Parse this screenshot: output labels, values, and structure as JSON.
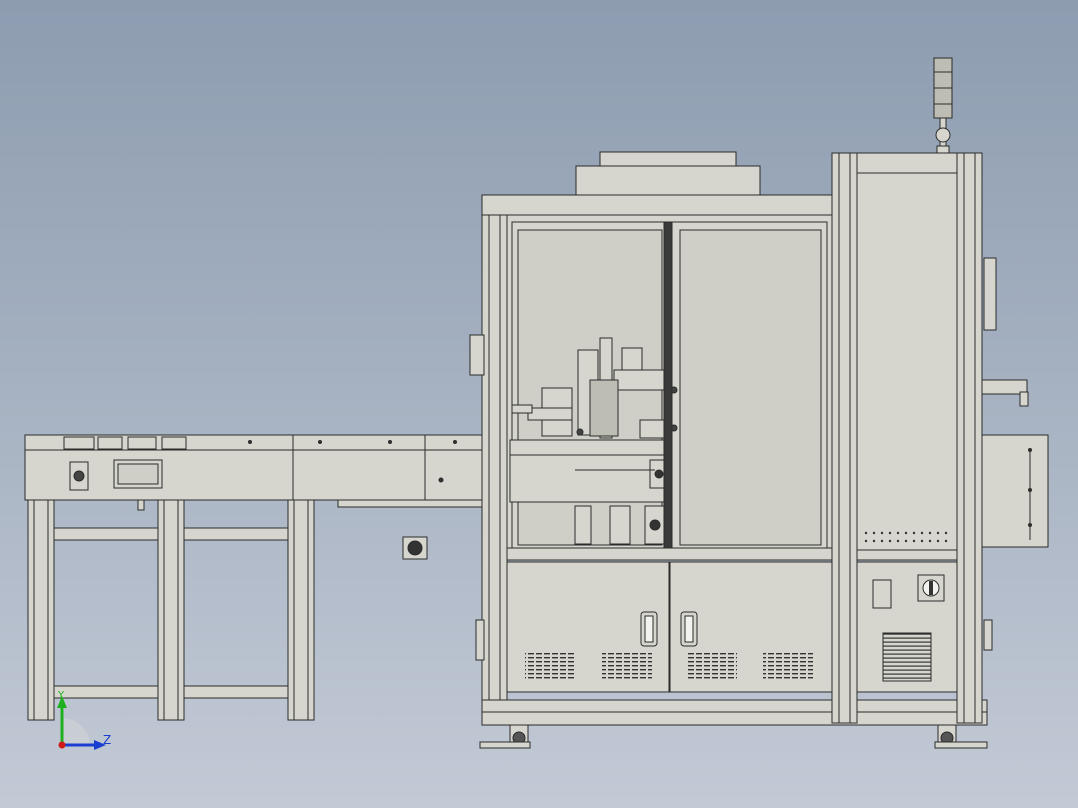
{
  "view": {
    "background_top": "#8d9cb0",
    "background_bottom": "#c3cad6",
    "part_fill": "#d6d6cf",
    "edge_color": "#2b2b2b"
  },
  "triad": {
    "y_label": "Y",
    "z_label": "Z",
    "y_color": "#1fb01f",
    "z_color": "#1a3fd0",
    "origin_color": "#d01a1a"
  }
}
